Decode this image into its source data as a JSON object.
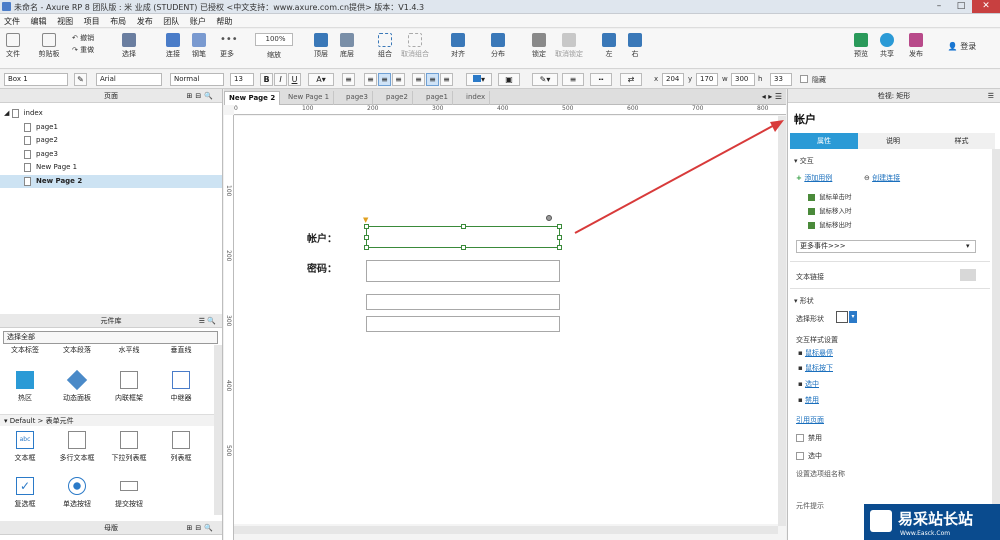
{
  "window": {
    "title": "未命名 - Axure RP 8 团队版 : 米 业成 (STUDENT) 已授权    <中文支持：www.axure.com.cn提供> 版本：V1.4.3",
    "controls": [
      "–",
      "□",
      "✕"
    ]
  },
  "menu": [
    "文件",
    "编辑",
    "视图",
    "项目",
    "布局",
    "发布",
    "团队",
    "账户",
    "帮助"
  ],
  "toolbar": {
    "file": "文件",
    "clipboard": "剪贴板",
    "undo": "撤销",
    "redo": "重做",
    "select": "选择",
    "connect": "连接",
    "pen": "钢笔",
    "more": "更多",
    "zoom_value": "100%",
    "zoom_label": "缩放",
    "top": "顶层",
    "bottom": "底层",
    "group": "组合",
    "ungroup": "取消组合",
    "align": "对齐",
    "distribute": "分布",
    "lock": "锁定",
    "unlock": "取消锁定",
    "left": "左",
    "right": "右",
    "preview": "预览",
    "share": "共享",
    "publish": "发布",
    "login": "登录"
  },
  "format": {
    "widget_type": "Box 1",
    "font": "Arial",
    "style": "Normal",
    "size": "13",
    "x_label": "x",
    "x": "204",
    "y_label": "y",
    "y": "170",
    "w_label": "w",
    "w": "300",
    "h_label": "h",
    "h": "33",
    "hidden_label": "隐藏"
  },
  "pages_panel": {
    "title": "页面",
    "items": [
      {
        "label": "index"
      },
      {
        "label": "page1"
      },
      {
        "label": "page2"
      },
      {
        "label": "page3"
      },
      {
        "label": "New Page 1"
      },
      {
        "label": "New Page 2"
      }
    ]
  },
  "library_panel": {
    "title": "元件库",
    "filter": "选择全部",
    "row1": [
      "文本标签",
      "文本段落",
      "水平线",
      "垂直线"
    ],
    "row2": [
      "热区",
      "动态面板",
      "内联框架",
      "中继器"
    ],
    "group_label": "Default > 表单元件",
    "row3": [
      "文本框",
      "多行文本框",
      "下拉列表框",
      "列表框"
    ],
    "row4": [
      "复选框",
      "单选按钮",
      "提交按钮"
    ]
  },
  "master_panel": {
    "title": "母版"
  },
  "tabs": [
    "New Page 2",
    "New Page 1",
    "page3",
    "page2",
    "page1",
    "index"
  ],
  "ruler": {
    "h": [
      "0",
      "100",
      "200",
      "300",
      "400",
      "500",
      "600",
      "700",
      "800"
    ],
    "v": [
      "100",
      "200",
      "300",
      "400",
      "500"
    ]
  },
  "canvas": {
    "account_label": "帐户：",
    "password_label": "密码："
  },
  "inspector": {
    "header": "检视: 矩形",
    "widget_name": "帐户",
    "tabs": [
      "属性",
      "说明",
      "样式"
    ],
    "interaction_title": "交互",
    "add_case": "添加用例",
    "create_link": "创建连接",
    "events": [
      "鼠标单击时",
      "鼠标移入时",
      "鼠标移出时"
    ],
    "more_events": "更多事件>>>",
    "text_link": "文本链接",
    "shape_title": "形状",
    "select_shape": "选择形状",
    "interaction_styles": "交互样式设置",
    "styles": [
      "鼠标悬停",
      "鼠标按下",
      "选中",
      "禁用"
    ],
    "ref_page": "引用页面",
    "disabled": "禁用",
    "selected": "选中",
    "group_name": "设置选项组名称",
    "tooltip": "元件提示"
  },
  "colors": {
    "accent": "#2b9ad6",
    "selection": "#3a8a3a",
    "arrow": "#d83a3a"
  },
  "watermark": {
    "brand": "易采站长站",
    "url": "Www.Easck.Com"
  }
}
